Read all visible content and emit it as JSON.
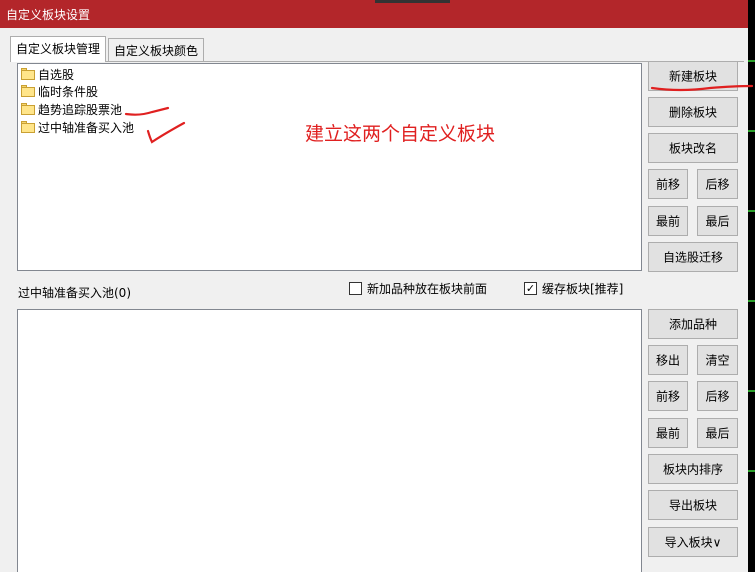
{
  "window": {
    "title": "自定义板块设置"
  },
  "tabs": [
    {
      "label": "自定义板块管理",
      "active": true
    },
    {
      "label": "自定义板块颜色",
      "active": false
    }
  ],
  "tree": {
    "items": [
      {
        "label": "自选股",
        "icon": "folder-icon"
      },
      {
        "label": "临时条件股",
        "icon": "folder-icon"
      },
      {
        "label": "趋势追踪股票池",
        "icon": "folder-icon"
      },
      {
        "label": "过中轴准备买入池",
        "icon": "folder-icon"
      }
    ]
  },
  "annotation": {
    "text": "建立这两个自定义板块",
    "color": "#e02020"
  },
  "block_buttons": {
    "new": "新建板块",
    "delete": "删除板块",
    "rename": "板块改名",
    "move_up": "前移",
    "move_down": "后移",
    "move_first": "最前",
    "move_last": "最后",
    "migrate": "自选股迁移"
  },
  "current_block": {
    "label": "过中轴准备买入池(0)"
  },
  "options": {
    "add_front": {
      "label": "新加品种放在板块前面",
      "checked": false
    },
    "cache": {
      "label": "缓存板块[推荐]",
      "checked": true
    }
  },
  "stock_buttons": {
    "add": "添加品种",
    "remove": "移出",
    "clear": "清空",
    "move_up": "前移",
    "move_down": "后移",
    "move_first": "最前",
    "move_last": "最后",
    "sort": "板块内排序",
    "export": "导出板块",
    "import": "导入板块∨"
  },
  "colors": {
    "titlebar": "#b3262a",
    "accent_red": "#e02020",
    "dialog_bg": "#f0f0f0"
  }
}
